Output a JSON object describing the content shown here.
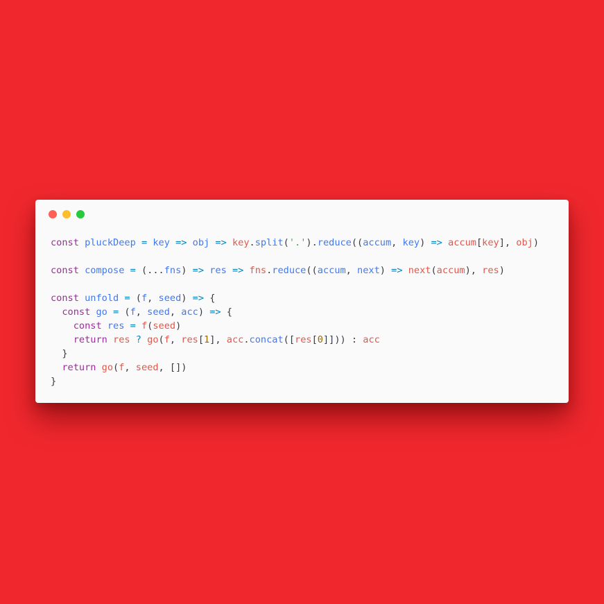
{
  "window": {
    "controls": {
      "close_color": "#ff5f56",
      "minimize_color": "#ffbd2e",
      "maximize_color": "#27c93f"
    }
  },
  "theme": {
    "background": "#f0282e",
    "editor_background": "#fafafa",
    "keyword": "#a626a4",
    "function": "#4078f2",
    "operator": "#0184bc",
    "variable": "#e45649",
    "string": "#50a14f",
    "number": "#986801",
    "punctuation": "#383a42"
  },
  "code": {
    "lines": [
      [
        {
          "t": "kw",
          "v": "const"
        },
        {
          "t": "pn",
          "v": " "
        },
        {
          "t": "fn",
          "v": "pluckDeep"
        },
        {
          "t": "pn",
          "v": " "
        },
        {
          "t": "op",
          "v": "="
        },
        {
          "t": "pn",
          "v": " "
        },
        {
          "t": "fn",
          "v": "key"
        },
        {
          "t": "pn",
          "v": " "
        },
        {
          "t": "op",
          "v": "=>"
        },
        {
          "t": "pn",
          "v": " "
        },
        {
          "t": "fn",
          "v": "obj"
        },
        {
          "t": "pn",
          "v": " "
        },
        {
          "t": "op",
          "v": "=>"
        },
        {
          "t": "pn",
          "v": " "
        },
        {
          "t": "var",
          "v": "key"
        },
        {
          "t": "pn",
          "v": "."
        },
        {
          "t": "fn",
          "v": "split"
        },
        {
          "t": "pn",
          "v": "("
        },
        {
          "t": "str",
          "v": "'.'"
        },
        {
          "t": "pn",
          "v": ")."
        },
        {
          "t": "fn",
          "v": "reduce"
        },
        {
          "t": "pn",
          "v": "(("
        },
        {
          "t": "fn",
          "v": "accum"
        },
        {
          "t": "pn",
          "v": ", "
        },
        {
          "t": "fn",
          "v": "key"
        },
        {
          "t": "pn",
          "v": ") "
        },
        {
          "t": "op",
          "v": "=>"
        },
        {
          "t": "pn",
          "v": " "
        },
        {
          "t": "var",
          "v": "accum"
        },
        {
          "t": "pn",
          "v": "["
        },
        {
          "t": "var",
          "v": "key"
        },
        {
          "t": "pn",
          "v": "], "
        },
        {
          "t": "var",
          "v": "obj"
        },
        {
          "t": "pn",
          "v": ")"
        }
      ],
      [],
      [
        {
          "t": "kw",
          "v": "const"
        },
        {
          "t": "pn",
          "v": " "
        },
        {
          "t": "fn",
          "v": "compose"
        },
        {
          "t": "pn",
          "v": " "
        },
        {
          "t": "op",
          "v": "="
        },
        {
          "t": "pn",
          "v": " (..."
        },
        {
          "t": "fn",
          "v": "fns"
        },
        {
          "t": "pn",
          "v": ") "
        },
        {
          "t": "op",
          "v": "=>"
        },
        {
          "t": "pn",
          "v": " "
        },
        {
          "t": "fn",
          "v": "res"
        },
        {
          "t": "pn",
          "v": " "
        },
        {
          "t": "op",
          "v": "=>"
        },
        {
          "t": "pn",
          "v": " "
        },
        {
          "t": "var",
          "v": "fns"
        },
        {
          "t": "pn",
          "v": "."
        },
        {
          "t": "fn",
          "v": "reduce"
        },
        {
          "t": "pn",
          "v": "(("
        },
        {
          "t": "fn",
          "v": "accum"
        },
        {
          "t": "pn",
          "v": ", "
        },
        {
          "t": "fn",
          "v": "next"
        },
        {
          "t": "pn",
          "v": ") "
        },
        {
          "t": "op",
          "v": "=>"
        },
        {
          "t": "pn",
          "v": " "
        },
        {
          "t": "var",
          "v": "next"
        },
        {
          "t": "pn",
          "v": "("
        },
        {
          "t": "var",
          "v": "accum"
        },
        {
          "t": "pn",
          "v": "), "
        },
        {
          "t": "var",
          "v": "res"
        },
        {
          "t": "pn",
          "v": ")"
        }
      ],
      [],
      [
        {
          "t": "kw",
          "v": "const"
        },
        {
          "t": "pn",
          "v": " "
        },
        {
          "t": "fn",
          "v": "unfold"
        },
        {
          "t": "pn",
          "v": " "
        },
        {
          "t": "op",
          "v": "="
        },
        {
          "t": "pn",
          "v": " ("
        },
        {
          "t": "fn",
          "v": "f"
        },
        {
          "t": "pn",
          "v": ", "
        },
        {
          "t": "fn",
          "v": "seed"
        },
        {
          "t": "pn",
          "v": ") "
        },
        {
          "t": "op",
          "v": "=>"
        },
        {
          "t": "pn",
          "v": " {"
        }
      ],
      [
        {
          "t": "pn",
          "v": "  "
        },
        {
          "t": "kw",
          "v": "const"
        },
        {
          "t": "pn",
          "v": " "
        },
        {
          "t": "fn",
          "v": "go"
        },
        {
          "t": "pn",
          "v": " "
        },
        {
          "t": "op",
          "v": "="
        },
        {
          "t": "pn",
          "v": " ("
        },
        {
          "t": "fn",
          "v": "f"
        },
        {
          "t": "pn",
          "v": ", "
        },
        {
          "t": "fn",
          "v": "seed"
        },
        {
          "t": "pn",
          "v": ", "
        },
        {
          "t": "fn",
          "v": "acc"
        },
        {
          "t": "pn",
          "v": ") "
        },
        {
          "t": "op",
          "v": "=>"
        },
        {
          "t": "pn",
          "v": " {"
        }
      ],
      [
        {
          "t": "pn",
          "v": "    "
        },
        {
          "t": "kw",
          "v": "const"
        },
        {
          "t": "pn",
          "v": " "
        },
        {
          "t": "fn",
          "v": "res"
        },
        {
          "t": "pn",
          "v": " "
        },
        {
          "t": "op",
          "v": "="
        },
        {
          "t": "pn",
          "v": " "
        },
        {
          "t": "var",
          "v": "f"
        },
        {
          "t": "pn",
          "v": "("
        },
        {
          "t": "var",
          "v": "seed"
        },
        {
          "t": "pn",
          "v": ")"
        }
      ],
      [
        {
          "t": "pn",
          "v": "    "
        },
        {
          "t": "kw",
          "v": "return"
        },
        {
          "t": "pn",
          "v": " "
        },
        {
          "t": "var",
          "v": "res"
        },
        {
          "t": "pn",
          "v": " "
        },
        {
          "t": "op",
          "v": "?"
        },
        {
          "t": "pn",
          "v": " "
        },
        {
          "t": "var",
          "v": "go"
        },
        {
          "t": "pn",
          "v": "("
        },
        {
          "t": "var",
          "v": "f"
        },
        {
          "t": "pn",
          "v": ", "
        },
        {
          "t": "var",
          "v": "res"
        },
        {
          "t": "pn",
          "v": "["
        },
        {
          "t": "num",
          "v": "1"
        },
        {
          "t": "pn",
          "v": "], "
        },
        {
          "t": "var",
          "v": "acc"
        },
        {
          "t": "pn",
          "v": "."
        },
        {
          "t": "fn",
          "v": "concat"
        },
        {
          "t": "pn",
          "v": "(["
        },
        {
          "t": "var",
          "v": "res"
        },
        {
          "t": "pn",
          "v": "["
        },
        {
          "t": "num",
          "v": "0"
        },
        {
          "t": "pn",
          "v": "]])) : "
        },
        {
          "t": "var",
          "v": "acc"
        }
      ],
      [
        {
          "t": "pn",
          "v": "  }"
        }
      ],
      [
        {
          "t": "pn",
          "v": "  "
        },
        {
          "t": "kw",
          "v": "return"
        },
        {
          "t": "pn",
          "v": " "
        },
        {
          "t": "var",
          "v": "go"
        },
        {
          "t": "pn",
          "v": "("
        },
        {
          "t": "var",
          "v": "f"
        },
        {
          "t": "pn",
          "v": ", "
        },
        {
          "t": "var",
          "v": "seed"
        },
        {
          "t": "pn",
          "v": ", [])"
        }
      ],
      [
        {
          "t": "pn",
          "v": "}"
        }
      ]
    ]
  }
}
